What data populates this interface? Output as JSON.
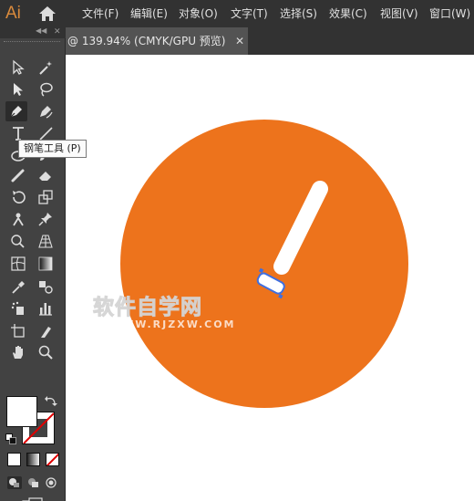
{
  "app": {
    "logo": "Ai"
  },
  "menu": [
    "文件(F)",
    "编辑(E)",
    "对象(O)",
    "文字(T)",
    "选择(S)",
    "效果(C)",
    "视图(V)",
    "窗口(W)"
  ],
  "document": {
    "tab_title": "@ 139.94% (CMYK/GPU 预览)",
    "close_label": "✕"
  },
  "tooltip": {
    "text": "钢笔工具 (P)"
  },
  "watermark": {
    "main": "软件自学网",
    "sub": "WWW.RJZXW.COM"
  },
  "tools": [
    [
      "selection-tool-icon",
      "magic-wand-tool-icon"
    ],
    [
      "direct-selection-tool-icon",
      "lasso-tool-icon"
    ],
    [
      "pen-tool-icon",
      "curvature-tool-icon"
    ],
    [
      "type-tool-icon",
      "line-segment-tool-icon"
    ],
    [
      "ellipse-tool-icon",
      "paintbrush-tool-icon"
    ],
    [
      "blob-brush-tool-icon",
      "eraser-tool-icon"
    ],
    [
      "rotate-tool-icon",
      "scale-tool-icon"
    ],
    [
      "puppet-warp-tool-icon",
      "pin-tool-icon"
    ],
    [
      "shape-builder-tool-icon",
      "perspective-grid-tool-icon"
    ],
    [
      "mesh-tool-icon",
      "gradient-tool-icon"
    ],
    [
      "eyedropper-tool-icon",
      "blend-tool-icon"
    ],
    [
      "symbol-sprayer-tool-icon",
      "column-graph-tool-icon"
    ],
    [
      "artboard-tool-icon",
      "slice-tool-icon"
    ],
    [
      "hand-tool-icon",
      "zoom-tool-icon"
    ]
  ],
  "colors": {
    "menubar": "#323232",
    "toolbar": "#424242",
    "artwork_orange": "#ed731c",
    "artwork_white": "#ffffff",
    "selection_blue": "#3f6fe0"
  }
}
